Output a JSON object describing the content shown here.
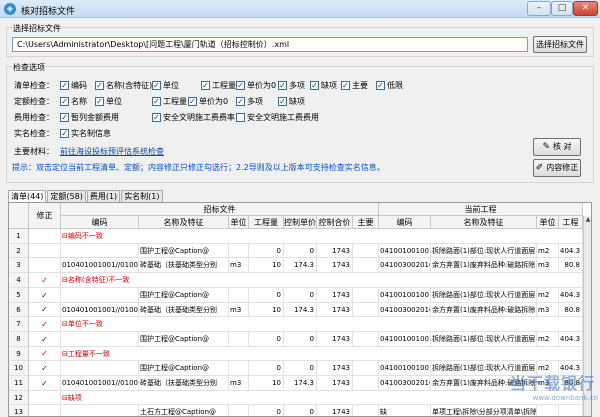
{
  "window": {
    "title": "核对招标文件",
    "app_icon": "logo-icon"
  },
  "file": {
    "group_label": "选择招标文件",
    "path": "C:\\Users\\Administrator\\Desktop\\[问题工程\\厦门轨道（招标控制价）.xml",
    "select_button": "选择招标文件"
  },
  "options": {
    "group_label": "检查选项",
    "rows": [
      {
        "label": "清单检查：",
        "items": [
          {
            "text": "编码",
            "checked": true
          },
          {
            "text": "名称(含特征)",
            "checked": true
          },
          {
            "text": "单位",
            "checked": true
          },
          {
            "text": "工程量",
            "checked": true
          },
          {
            "text": "单价为0",
            "checked": true
          },
          {
            "text": "多项",
            "checked": true
          },
          {
            "text": "缺项",
            "checked": true
          },
          {
            "text": "主要",
            "checked": true
          },
          {
            "text": "低限",
            "checked": true
          }
        ]
      },
      {
        "label": "定额检查：",
        "items": [
          {
            "text": "名称",
            "checked": true
          },
          {
            "text": "单位",
            "checked": true
          },
          {
            "text": "工程量",
            "checked": true
          },
          {
            "text": "单价为0",
            "checked": true
          },
          {
            "text": "多项",
            "checked": true
          },
          {
            "text": "缺项",
            "checked": true
          }
        ]
      },
      {
        "label": "费用检查：",
        "items": [
          {
            "text": "暂列金额费用",
            "checked": true
          },
          {
            "text": "安全文明施工费费率",
            "checked": true
          },
          {
            "text": "安全文明施工费费用",
            "checked": false
          }
        ]
      },
      {
        "label": "实名检查：",
        "items": [
          {
            "text": "实名制信息",
            "checked": true
          }
        ]
      }
    ],
    "materials_label": "主要材料：",
    "materials_link": "前往海设投标预评估系统检查",
    "hint": "提示：双击定位当前工程清单、定额；内容修正只修正勾选行；2.2导则及以上版本可支持检查实名信息。",
    "check_button": "核 对",
    "fix_button": "内容修正"
  },
  "tabs": [
    {
      "label": "清单(44)",
      "active": true
    },
    {
      "label": "定额(58)",
      "active": false
    },
    {
      "label": "费用(1)",
      "active": false
    },
    {
      "label": "实名制(1)",
      "active": false
    }
  ],
  "grid": {
    "fix_header": "修正",
    "bid_header": "招标文件",
    "current_header": "当前工程",
    "columns_bid": [
      "编码",
      "名称及特征",
      "单位",
      "工程量",
      "控制单价",
      "控制合价",
      "主要"
    ],
    "columns_cur": [
      "编码",
      "名称及特征",
      "单位",
      "工程"
    ],
    "rows": [
      {
        "n": "1",
        "group": "编码不一致",
        "fix": ""
      },
      {
        "n": "2",
        "fix": "",
        "b": [
          "",
          "围护工程@Caption@",
          "",
          "0",
          "0",
          "1743",
          ""
        ],
        "c": [
          "041001001001",
          "拆除路面(1)部位:现状人行道面层",
          "m2",
          "404.3"
        ]
      },
      {
        "n": "3",
        "fix": "",
        "b": [
          "010401001001//01004",
          "砖基础（扶基础类型分别",
          "m3",
          "10",
          "174.3",
          "1743",
          ""
        ],
        "c": [
          "041003002016",
          "余方弃置(1)废弃料品种:破路拆除",
          "m3",
          "80.8"
        ]
      },
      {
        "n": "4",
        "group": "名称(含特征)不一致",
        "fix": "bad"
      },
      {
        "n": "5",
        "fix": "ok",
        "b": [
          "",
          "围护工程@Caption@",
          "",
          "0",
          "0",
          "1743",
          ""
        ],
        "c": [
          "041001001001",
          "拆除路面(1)部位:现状人行道面层",
          "m2",
          "404.3"
        ]
      },
      {
        "n": "6",
        "fix": "ok",
        "b": [
          "010401001001//01004",
          "砖基础（扶基础类型分别",
          "m3",
          "10",
          "174.3",
          "1743",
          ""
        ],
        "c": [
          "041003002016",
          "余方弃置(1)废弃料品种:破路拆除",
          "m3",
          "80.8"
        ]
      },
      {
        "n": "7",
        "group": "单位不一致",
        "fix": "bad"
      },
      {
        "n": "8",
        "fix": "ok",
        "b": [
          "",
          "围护工程@Caption@",
          "",
          "0",
          "0",
          "1743",
          ""
        ],
        "c": [
          "041001001001",
          "拆除路面(1)部位:现状人行道面层",
          "m2",
          "404.3"
        ]
      },
      {
        "n": "9",
        "group": "工程量不一致",
        "fix": "bad"
      },
      {
        "n": "10",
        "fix": "ok",
        "b": [
          "",
          "围护工程@Caption@",
          "",
          "0",
          "0",
          "1743",
          ""
        ],
        "c": [
          "041001001001",
          "拆除路面(1)部位:现状人行道面层",
          "m2",
          "404.3"
        ]
      },
      {
        "n": "11",
        "fix": "ok",
        "b": [
          "010401001001//01004",
          "砖基础（扶基础类型分别",
          "m3",
          "10",
          "174.3",
          "1743",
          ""
        ],
        "c": [
          "041003002016",
          "余方弃置(1)废弃料品种:破路拆除",
          "m3",
          "80.8"
        ]
      },
      {
        "n": "12",
        "group": "缺项",
        "fix": ""
      },
      {
        "n": "13",
        "fix": "",
        "b": [
          "",
          "土石方工程@Caption@",
          "",
          "0",
          "0",
          "1743",
          ""
        ],
        "c": [
          "缺",
          "单项工程\\拆除\\分部分项清单\\拆除",
          "",
          ""
        ]
      }
    ]
  },
  "watermark": {
    "main": "当下载银行",
    "sub": "www.downbank.cn"
  }
}
